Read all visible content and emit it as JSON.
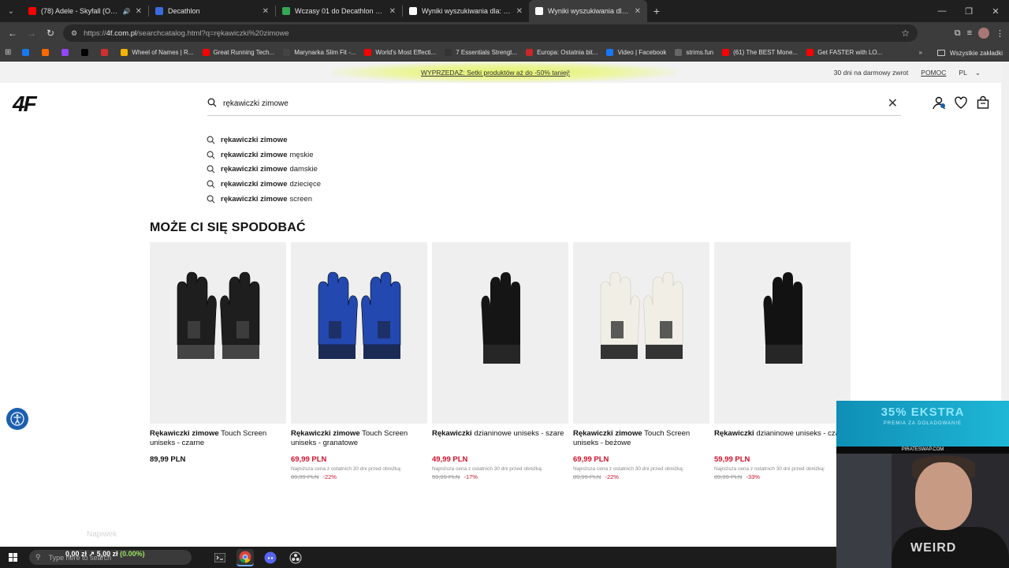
{
  "browser": {
    "tabs": [
      {
        "title": "(78) Adele - Skyfall (Official",
        "favicon_color": "#ff0000",
        "icon": "youtube-icon",
        "audio": true
      },
      {
        "title": "Decathlon",
        "favicon_color": "#3b6be0",
        "icon": "decathlon-icon"
      },
      {
        "title": "Wczasy 01 do Decathlon Gdańs",
        "favicon_color": "#34a853",
        "icon": "maps-pin-icon"
      },
      {
        "title": "Wyniki wyszukiwania dla: rękaw",
        "favicon_color": "#ffffff",
        "icon": "4f-icon"
      },
      {
        "title": "Wyniki wyszukiwania dla: rękaw",
        "favicon_color": "#ffffff",
        "icon": "4f-icon",
        "active": true
      }
    ],
    "url_prefix": "https://",
    "url_host": "4f.com.pl",
    "url_path": "/searchcatalog.html?q=rękawiczki%20zimowe",
    "bookmarks": [
      {
        "label": "",
        "color": "#1877f2"
      },
      {
        "label": "",
        "color": "#ff6a00"
      },
      {
        "label": "",
        "color": "#9146ff"
      },
      {
        "label": "",
        "color": "#000000"
      },
      {
        "label": "",
        "color": "#d32f2f"
      },
      {
        "label": "Wheel of Names | R...",
        "color": "#f4b400"
      },
      {
        "label": "Great Running Tech...",
        "color": "#ff0000"
      },
      {
        "label": "Marynarka Slim Fit -...",
        "color": "#444444"
      },
      {
        "label": "World's Most Effecti...",
        "color": "#ff0000"
      },
      {
        "label": "7 Essentials Strengt...",
        "color": "#333333"
      },
      {
        "label": "Europa: Ostatnia bit...",
        "color": "#c62828"
      },
      {
        "label": "Video | Facebook",
        "color": "#1877f2"
      },
      {
        "label": "strims.fun",
        "color": "#666666"
      },
      {
        "label": "(61) The BEST Mone...",
        "color": "#ff0000"
      },
      {
        "label": "Get FASTER with LO...",
        "color": "#ff0000"
      }
    ],
    "all_bookmarks": "Wszystkie zakładki"
  },
  "promo": {
    "text": "WYPRZEDAŻ: Setki produktów aż do -50% taniej!",
    "free_return": "30 dni na darmowy zwrot",
    "help": "POMOC",
    "lang": "PL"
  },
  "header": {
    "logo": "4F",
    "search_value": "rękawiczki zimowe"
  },
  "suggestions": [
    {
      "bold": "rękawiczki zimowe",
      "rest": ""
    },
    {
      "bold": "rękawiczki zimowe",
      "rest": "męskie"
    },
    {
      "bold": "rękawiczki zimowe",
      "rest": "damskie"
    },
    {
      "bold": "rękawiczki zimowe",
      "rest": "dziecięce"
    },
    {
      "bold": "rękawiczki zimowe",
      "rest": "screen"
    }
  ],
  "section_title": "MOŻE CI SIĘ SPODOBAĆ",
  "products": [
    {
      "bold": "Rękawiczki zimowe",
      "rest": " Touch Screen uniseks - czarne",
      "price": "89,99 PLN",
      "sale": false,
      "lowest": "",
      "old_price": "",
      "discount": "",
      "glove_color": "#1e1e1e",
      "accent": "#444"
    },
    {
      "bold": "Rękawiczki zimowe",
      "rest": " Touch Screen uniseks - granatowe",
      "price": "69,99 PLN",
      "sale": true,
      "lowest": "Najniższa cena z ostatnich 30 dni przed obniżką:",
      "old_price": "89,99 PLN",
      "discount": "-22%",
      "glove_color": "#2348b0",
      "accent": "#1c2b55"
    },
    {
      "bold": "Rękawiczki",
      "rest": " dzianinowe uniseks - szare",
      "price": "49,99 PLN",
      "sale": true,
      "lowest": "Najniższa cena z ostatnich 30 dni przed obniżką:",
      "old_price": "59,99 PLN",
      "discount": "-17%",
      "glove_color": "#151515",
      "accent": "#262626"
    },
    {
      "bold": "Rękawiczki zimowe",
      "rest": " Touch Screen uniseks - beżowe",
      "price": "69,99 PLN",
      "sale": true,
      "lowest": "Najniższa cena z ostatnich 30 dni przed obniżką:",
      "old_price": "89,99 PLN",
      "discount": "-22%",
      "glove_color": "#f1eee6",
      "accent": "#333"
    },
    {
      "bold": "Rękawiczki",
      "rest": " dzianinowe uniseks - czarne",
      "price": "59,99 PLN",
      "sale": true,
      "lowest": "Najniższa cena z ostatnich 30 dni przed obniżką:",
      "old_price": "89,99 PLN",
      "discount": "-33%",
      "glove_color": "#121212",
      "accent": "#262626"
    }
  ],
  "overlay": {
    "napiwek": "Napiwek",
    "webcam_banner_big": "35% EKSTRA",
    "webcam_banner_small": "PREMIA ZA DOŁADOWANIE",
    "webcam_site": "PIRATESWAP.COM",
    "shirt_text": "WEIRD"
  },
  "taskbar": {
    "search_placeholder": "Type here to search",
    "ticker_a": "0,00 zł",
    "ticker_sep": " ↗ ",
    "ticker_b": "5,00 zł",
    "ticker_pct": "(0.00%)"
  }
}
